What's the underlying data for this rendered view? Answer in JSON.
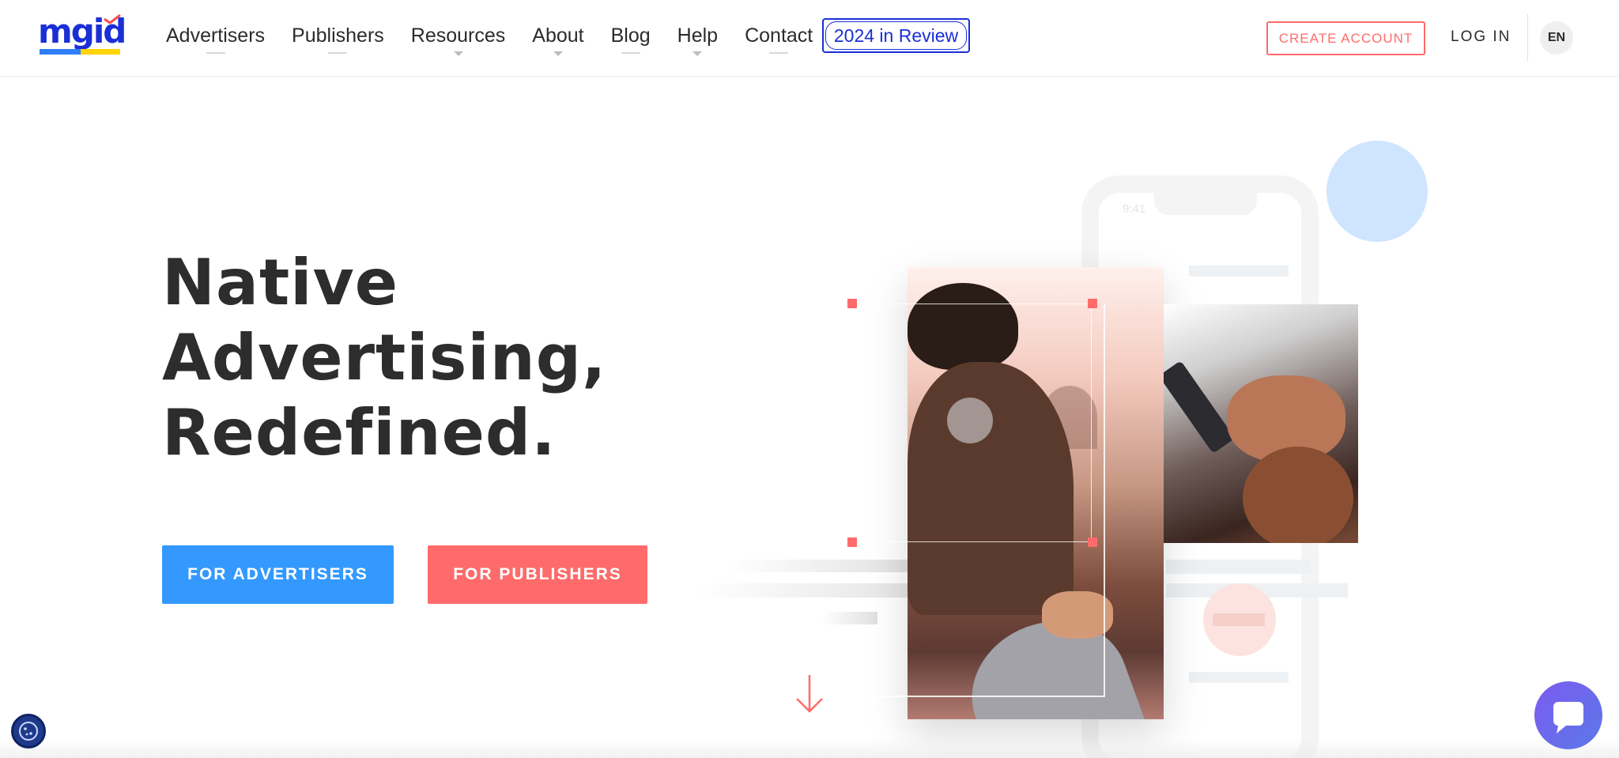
{
  "header": {
    "logo_text": "mgid",
    "nav": [
      {
        "label": "Advertisers",
        "has_dropdown": false
      },
      {
        "label": "Publishers",
        "has_dropdown": false
      },
      {
        "label": "Resources",
        "has_dropdown": true
      },
      {
        "label": "About",
        "has_dropdown": true
      },
      {
        "label": "Blog",
        "has_dropdown": false
      },
      {
        "label": "Help",
        "has_dropdown": true
      },
      {
        "label": "Contact",
        "has_dropdown": false
      }
    ],
    "review_label": "2024 in Review",
    "create_account_label": "CREATE ACCOUNT",
    "login_label": "LOG IN",
    "language": "EN"
  },
  "hero": {
    "title_lines": [
      "Native",
      "Advertising,",
      "Redefined."
    ],
    "advertisers_button": "FOR ADVERTISERS",
    "publishers_button": "FOR PUBLISHERS"
  },
  "illustration": {
    "phone_time": "9:41"
  },
  "colors": {
    "brand_blue": "#1a2fd6",
    "accent_blue": "#3399ff",
    "accent_coral": "#ff6b6b",
    "chat_purple": "#6b6bf0"
  },
  "icons": {
    "cookie": "cookie-icon",
    "chat": "chat-bubble-icon",
    "scroll": "arrow-down-icon"
  }
}
